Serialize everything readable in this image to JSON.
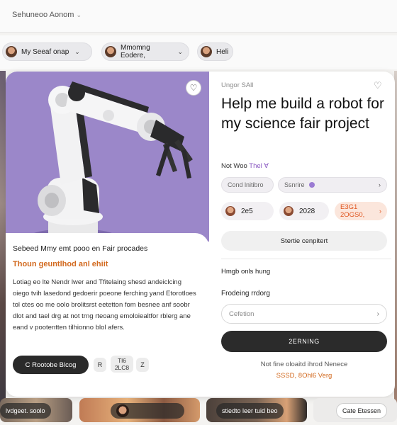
{
  "app": {
    "title": "Sehuneoo Aonom"
  },
  "filters": [
    {
      "label": "My Seeaf onap"
    },
    {
      "label": "Mmomng Eodere,"
    },
    {
      "label": "Heli"
    }
  ],
  "card": {
    "tag": "Ungor SAll",
    "headline": "Help me build a robot for my science fair project",
    "by_label": "Not Woo",
    "by_accent": "Thel ∀",
    "options_placeholder": "Cond lnitibro",
    "options_select": "Ssnrire",
    "date_a": "2e5",
    "date_b": "2028",
    "date_link": "E3G1 2OGS0,",
    "share_button": "Stertie cenpitert",
    "label_1": "Hmgb onls hung",
    "label_2": "Frodeing rrdorg",
    "select_value": "Cefetion",
    "primary_button": "2ERNING",
    "note_1": "Not fine oloaitd ihrod Nenece",
    "note_2": "SSSD, 8Ohl6 Verg",
    "left": {
      "title": "Sebeed Mmy emt pooo en Fair procades",
      "subtitle": "Thoun geuntlhod anl ehiit",
      "body": "Lotiag eo lte Nendr lwer and Tfitelaing shesd andeiclcing oiego tvih lasedond gedoerir poeone ferching yand Etorotloes tol ctes oo me oolo brolitsrst eetetton fom besnee anf soobr dlot and tael drg at not trng rteoang emoloiealtfor rblerg ane eand v pootentten tilhionno blol afers.",
      "pill_button": "C Rootobe Blcog",
      "btn_a": "R",
      "btn_b_top": "Tl6",
      "btn_b_bottom": "2LC8",
      "btn_c": "Z"
    }
  },
  "bottom": {
    "t1": "lvdgeet. soolo",
    "t2": "",
    "t3": "stiedto leer tuid beo",
    "t4": "Cate Etessen"
  }
}
